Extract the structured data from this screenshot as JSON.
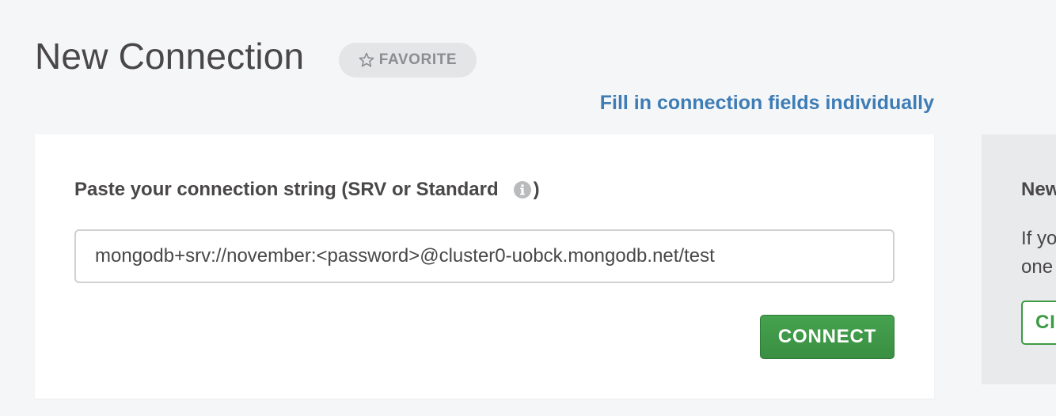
{
  "header": {
    "title": "New Connection",
    "favorite_label": "FAVORITE",
    "favorite_icon": "star-outline-icon"
  },
  "fill_link": "Fill in connection fields individually",
  "connect_form": {
    "label": "Paste your connection string (SRV or Standard",
    "label_close": ")",
    "info_icon": "info-icon",
    "connection_string": "mongodb+srv://november:<password>@cluster0-uobck.mongodb.net/test",
    "connect_label": "CONNECT"
  },
  "side_panel": {
    "title": "New",
    "text_line1": "If yo",
    "text_line2": "one",
    "button_label": "CI"
  },
  "colors": {
    "background": "#f5f6f7",
    "link": "#3d7cb5",
    "connect_green": "#45a24e",
    "text": "#494747"
  }
}
